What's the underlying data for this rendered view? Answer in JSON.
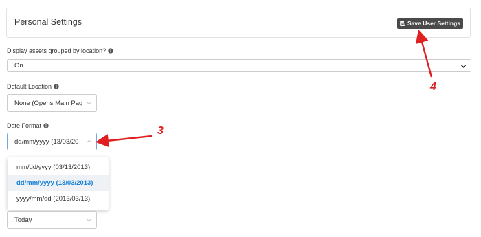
{
  "panel": {
    "title": "Personal Settings",
    "save_label": "Save User Settings",
    "save_icon": "floppy-disk-icon"
  },
  "fields": {
    "grouped": {
      "label": "Display assets grouped by location?",
      "value": "On"
    },
    "default_location": {
      "label": "Default Location",
      "value": "None (Opens Main Pag"
    },
    "date_format": {
      "label": "Date Format",
      "value": "dd/mm/yyyy (13/03/20",
      "options": [
        "mm/dd/yyyy (03/13/2013)",
        "dd/mm/yyyy (13/03/2013)",
        "yyyy/mm/dd (2013/03/13)"
      ],
      "selected_index": 1
    },
    "hidden_field": {
      "value": "Today"
    }
  },
  "annotations": {
    "arrow3_label": "3",
    "arrow4_label": "4",
    "color": "#e02020"
  },
  "colors": {
    "button_bg": "#4a4a4a",
    "selected_option_text": "#1a82d6",
    "active_border": "#6fa8dc"
  }
}
